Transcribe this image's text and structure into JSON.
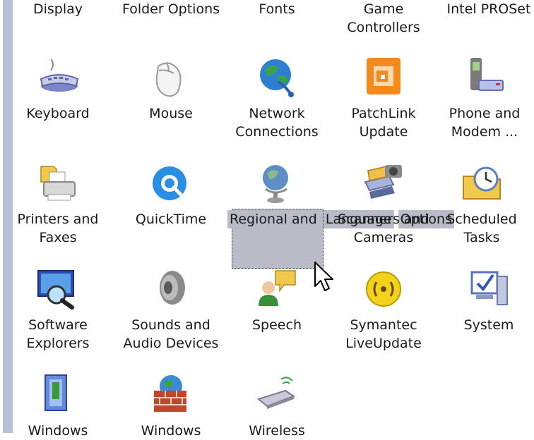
{
  "control_panel": {
    "items": [
      {
        "line1": "Display",
        "line2": ""
      },
      {
        "line1": "Folder Options",
        "line2": ""
      },
      {
        "line1": "Fonts",
        "line2": ""
      },
      {
        "line1": "Game",
        "line2": "Controllers"
      },
      {
        "line1": "Intel PROSet",
        "line2": ""
      },
      {
        "line1": "Keyboard",
        "line2": ""
      },
      {
        "line1": "Mouse",
        "line2": ""
      },
      {
        "line1": "Network",
        "line2": "Connections"
      },
      {
        "line1": "PatchLink",
        "line2": "Update"
      },
      {
        "line1": "Phone and",
        "line2": "Modem ..."
      },
      {
        "line1": "Printers and",
        "line2": "Faxes"
      },
      {
        "line1": "QuickTime",
        "line2": ""
      },
      {
        "line1": "Regional and",
        "line2": "Language",
        "line3": "Options"
      },
      {
        "line1": "Scanners and",
        "line2": "Cameras"
      },
      {
        "line1": "Scheduled",
        "line2": "Tasks"
      },
      {
        "line1": "Software",
        "line2": "Explorers"
      },
      {
        "line1": "Sounds and",
        "line2": "Audio Devices"
      },
      {
        "line1": "Speech",
        "line2": ""
      },
      {
        "line1": "Symantec",
        "line2": "LiveUpdate"
      },
      {
        "line1": "System",
        "line2": ""
      },
      {
        "line1": "Windows",
        "line2": ""
      },
      {
        "line1": "Windows",
        "line2": ""
      },
      {
        "line1": "Wireless",
        "line2": ""
      }
    ],
    "selected_item": "Regional and Language Options"
  }
}
